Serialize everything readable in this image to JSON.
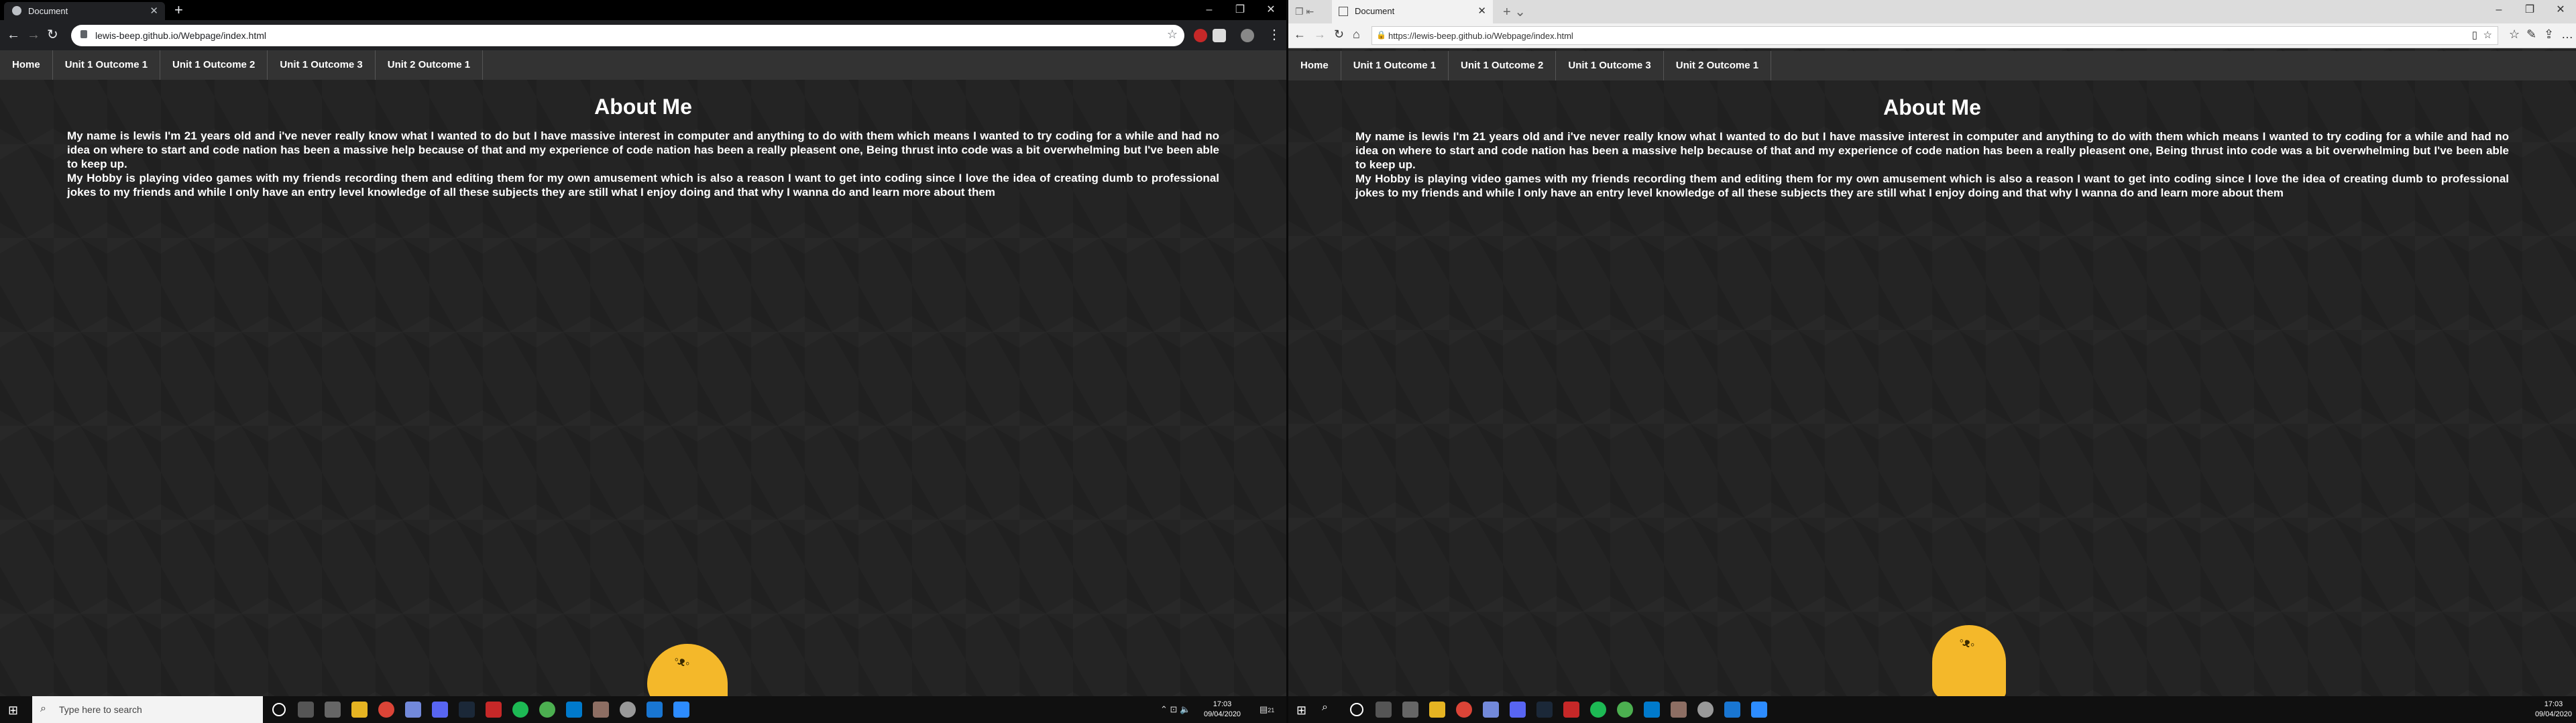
{
  "left": {
    "tab_title": "Document",
    "url": "lewis-beep.github.io/Webpage/index.html"
  },
  "right": {
    "tab_title": "Document",
    "url": "https://lewis-beep.github.io/Webpage/index.html"
  },
  "site": {
    "nav": [
      "Home",
      "Unit 1 Outcome 1",
      "Unit 1 Outcome 2",
      "Unit 1 Outcome 3",
      "Unit 2 Outcome 1"
    ],
    "heading": "About Me",
    "paragraph1": "My name is lewis I'm 21 years old and i've never really know what I wanted to do but I have massive interest in computer and anything to do with them which means I wanted to try coding for a while and had no idea on where to start and code nation has been a massive help because of that and my experience of code nation has been a really pleasent one, Being thrust into code was a bit overwhelming but I've been able to keep up.",
    "paragraph2": "My Hobby is playing video games with my friends recording them and editing them for my own amusement which is also a reason I want to get into coding since I love the idea of creating dumb to professional jokes to my friends and while I only have an entry level knowledge of all these subjects they are still what I enjoy doing and that why I wanna do and learn more about them"
  },
  "taskbar": {
    "search_placeholder": "Type here to search",
    "left_time": "17:03",
    "left_date": "09/04/2020",
    "right_time": "17:03",
    "right_date": "09/04/2020",
    "notif_count": "21"
  },
  "colors": {
    "blob": "#f4b82a",
    "nav_bg": "#333333",
    "page_bg": "#242424"
  }
}
